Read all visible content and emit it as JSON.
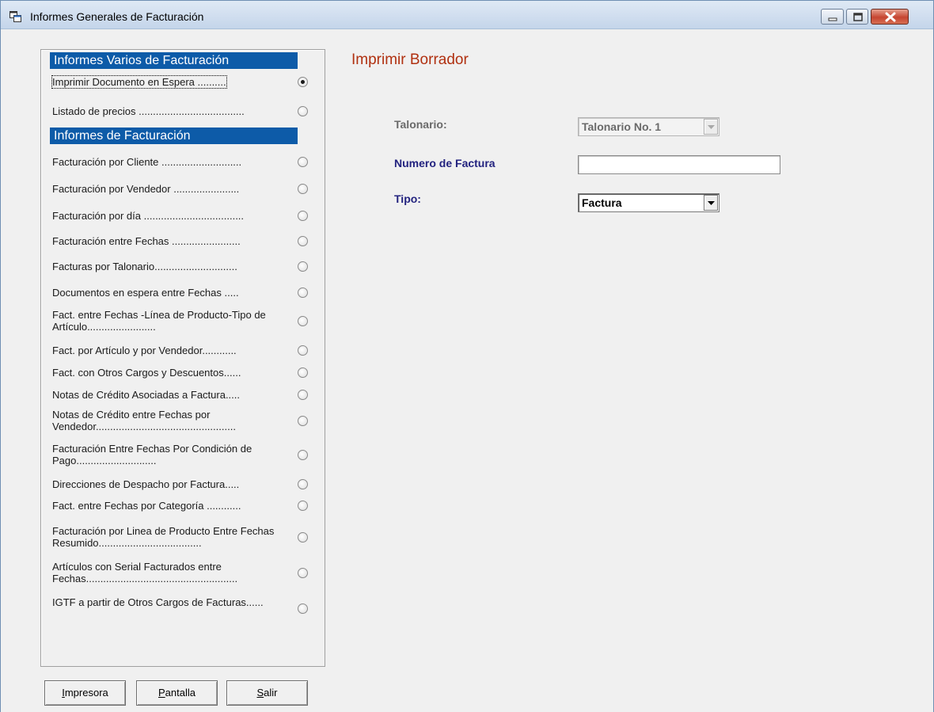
{
  "window": {
    "title": "Informes Generales de Facturación",
    "icon": "app-window-icon"
  },
  "panel": {
    "sections": [
      {
        "header": "Informes Varios de Facturación",
        "options": [
          {
            "label": "Imprimir Documento en Espera ..........",
            "checked": true
          },
          {
            "label": "Listado de precios .....................................",
            "checked": false
          }
        ]
      },
      {
        "header": "Informes de Facturación",
        "options": [
          {
            "label": "Facturación por Cliente ............................",
            "checked": false
          },
          {
            "label": "Facturación por Vendedor .......................",
            "checked": false
          },
          {
            "label": "Facturación por día ...................................",
            "checked": false
          },
          {
            "label": "Facturación entre Fechas ........................",
            "checked": false
          },
          {
            "label": "Facturas por Talonario.............................",
            "checked": false
          },
          {
            "label": "Documentos en espera entre Fechas .....",
            "checked": false
          },
          {
            "label": "Fact. entre Fechas -Línea de Producto-Tipo de Artículo........................",
            "checked": false
          },
          {
            "label": "Fact. por Artículo y por Vendedor............",
            "checked": false
          },
          {
            "label": "Fact. con Otros Cargos y Descuentos......",
            "checked": false
          },
          {
            "label": "Notas de Crédito Asociadas a Factura.....",
            "checked": false
          },
          {
            "label": "Notas de Crédito entre Fechas por Vendedor.................................................",
            "checked": false
          },
          {
            "label": "Facturación Entre Fechas Por Condición de Pago............................",
            "checked": false
          },
          {
            "label": "Direcciones de Despacho por Factura.....",
            "checked": false
          },
          {
            "label": "Fact. entre Fechas por Categoría ............",
            "checked": false
          },
          {
            "label": "Facturación por Linea de Producto Entre Fechas Resumido....................................",
            "checked": false
          },
          {
            "label": "Artículos con Serial Facturados entre Fechas.....................................................",
            "checked": false
          },
          {
            "label": "IGTF a partir de Otros Cargos de Facturas......",
            "checked": false
          }
        ]
      }
    ]
  },
  "report": {
    "title": "Imprimir Borrador",
    "fields": {
      "talonario": {
        "label": "Talonario:",
        "value": "Talonario No. 1"
      },
      "numero": {
        "label": "Numero de Factura",
        "value": ""
      },
      "tipo": {
        "label": "Tipo:",
        "value": "Factura"
      }
    }
  },
  "buttons": {
    "impresora": {
      "mnemonic": "I",
      "rest": "mpresora"
    },
    "pantalla": {
      "mnemonic": "P",
      "rest": "antalla"
    },
    "salir": {
      "mnemonic": "S",
      "rest": "alir"
    }
  },
  "colors": {
    "section_header_bg": "#0d5ba8",
    "report_title": "#b03010",
    "label_navy": "#23237f",
    "label_gray": "#6a6a6a"
  }
}
